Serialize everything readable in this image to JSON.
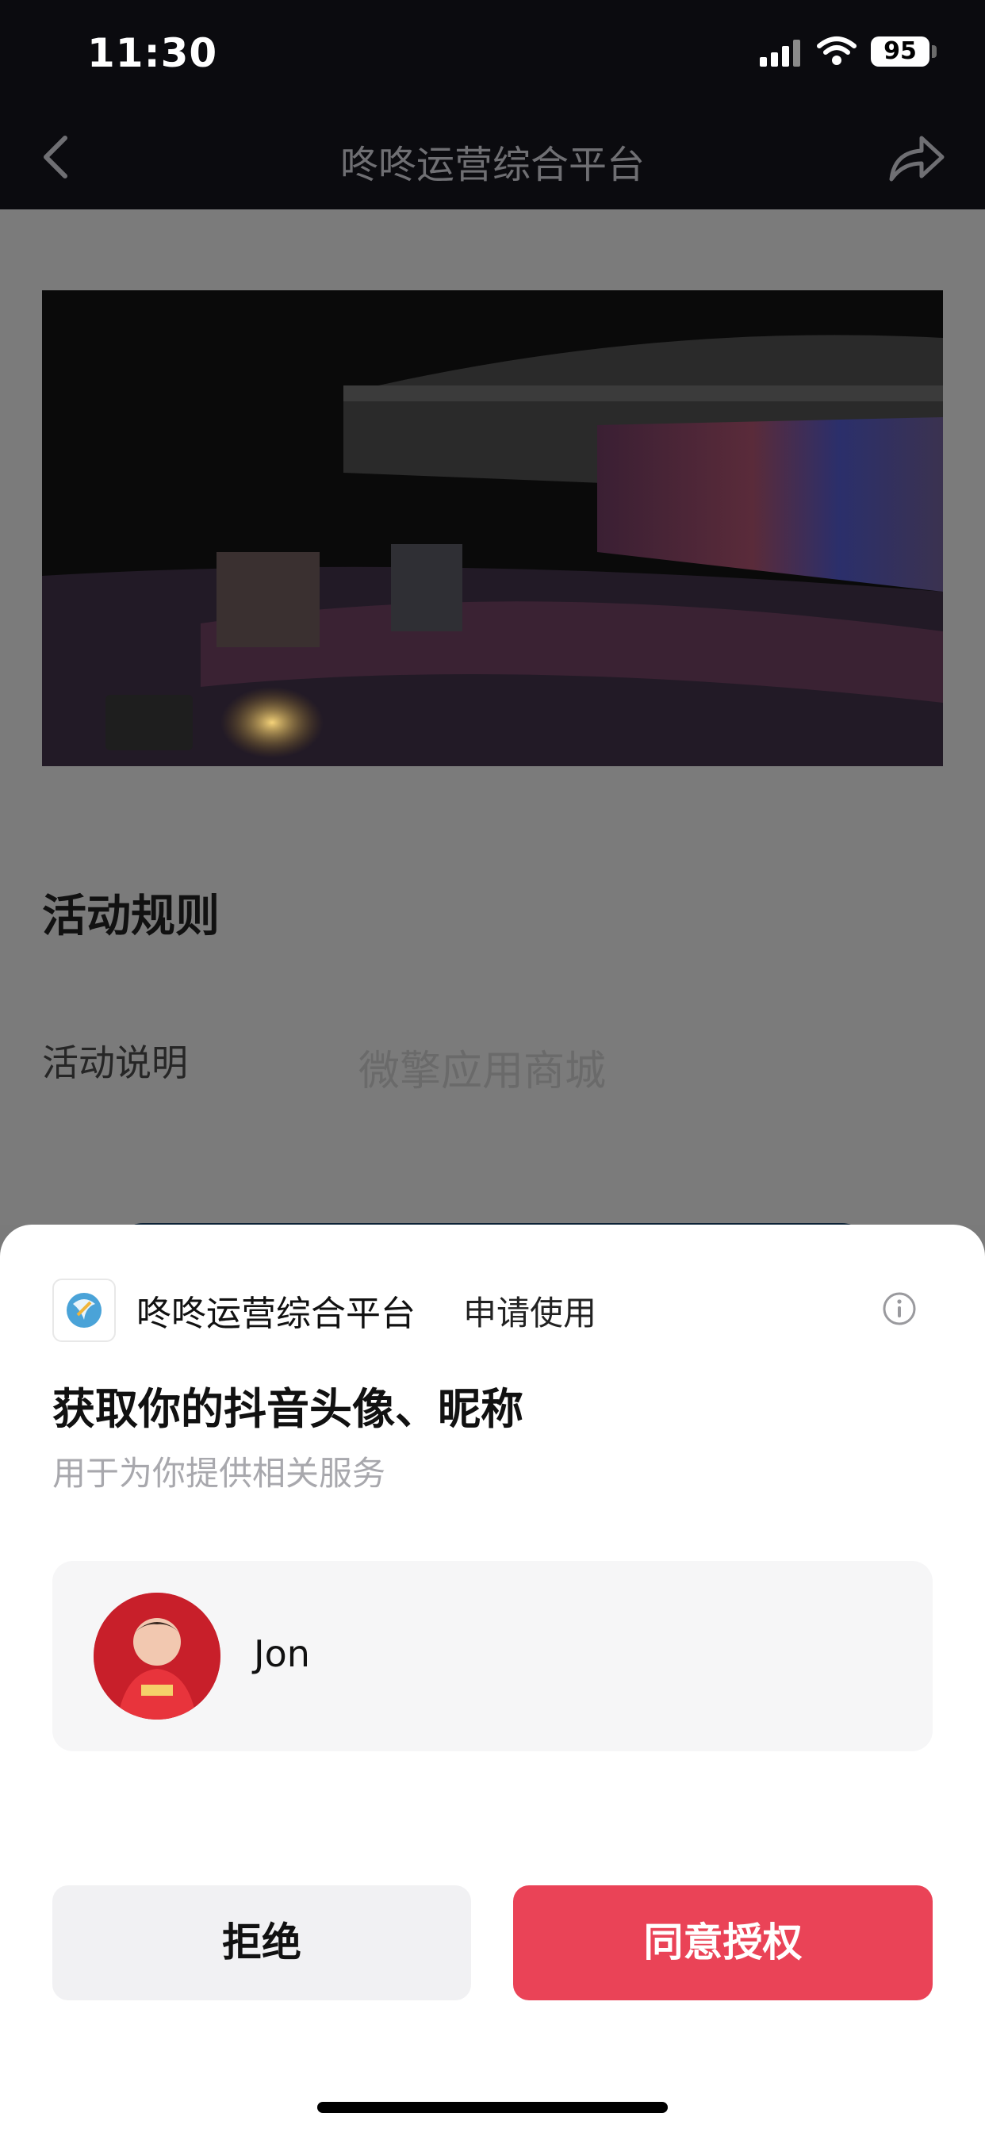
{
  "status_bar": {
    "time": "11:30",
    "battery": "95"
  },
  "nav": {
    "title": "咚咚运营综合平台"
  },
  "page": {
    "rules_title": "活动规则",
    "rules_label": "活动说明",
    "watermark": "微擎应用商城"
  },
  "sheet": {
    "app_name": "咚咚运营综合平台",
    "request_text": "申请使用",
    "title": "获取你的抖音头像、昵称",
    "subtitle": "用于为你提供相关服务",
    "account_name": "Jon",
    "reject_label": "拒绝",
    "agree_label": "同意授权"
  },
  "colors": {
    "agree": "#ea4357",
    "reject": "#f1f1f3",
    "overlay": "#7b7b7b"
  },
  "icons": [
    "back-arrow-icon",
    "share-icon",
    "info-icon",
    "app-logo-icon",
    "signal-icon",
    "wifi-icon",
    "battery-icon"
  ]
}
